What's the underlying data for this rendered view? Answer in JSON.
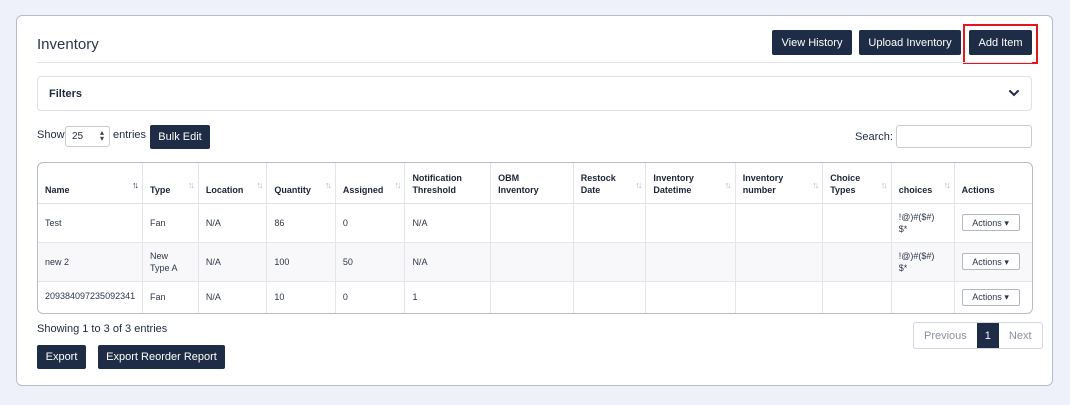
{
  "page": {
    "title": "Inventory"
  },
  "header_buttons": {
    "view_history": "View History",
    "upload_inventory": "Upload Inventory",
    "add_item": "Add Item"
  },
  "filters": {
    "label": "Filters"
  },
  "controls": {
    "show_label": "Show",
    "entries_value": "25",
    "entries_label": "entries",
    "bulk_edit": "Bulk Edit",
    "search_label": "Search:",
    "search_value": ""
  },
  "table": {
    "columns": [
      "Name",
      "Type",
      "Location",
      "Quantity",
      "Assigned",
      "Notification Threshold",
      "OBM Inventory",
      "Restock Date",
      "Inventory Datetime",
      "Inventory number",
      "Choice Types",
      "choices",
      "Actions"
    ],
    "rows": [
      {
        "name": "Test",
        "type": "Fan",
        "location": "N/A",
        "quantity": "86",
        "assigned": "0",
        "threshold": "N/A",
        "obm": "",
        "restock": "",
        "datetime": "",
        "number": "",
        "choice_types": "",
        "choices": "!@)#($#)$*",
        "action": "Actions"
      },
      {
        "name": "new 2",
        "type": "New Type A",
        "location": "N/A",
        "quantity": "100",
        "assigned": "50",
        "threshold": "N/A",
        "obm": "",
        "restock": "",
        "datetime": "",
        "number": "",
        "choice_types": "",
        "choices": "!@)#($#)$*",
        "action": "Actions"
      },
      {
        "name": "209384097235092341",
        "type": "Fan",
        "location": "N/A",
        "quantity": "10",
        "assigned": "0",
        "threshold": "1",
        "obm": "",
        "restock": "",
        "datetime": "",
        "number": "",
        "choice_types": "",
        "choices": "",
        "action": "Actions"
      }
    ]
  },
  "footer": {
    "showing": "Showing 1 to 3 of 3 entries",
    "export": "Export",
    "export_reorder": "Export Reorder Report"
  },
  "pagination": {
    "previous": "Previous",
    "current": "1",
    "next": "Next"
  },
  "colors": {
    "primary": "#1e2c45",
    "highlight": "#e3171b",
    "background": "#eef1fa"
  }
}
